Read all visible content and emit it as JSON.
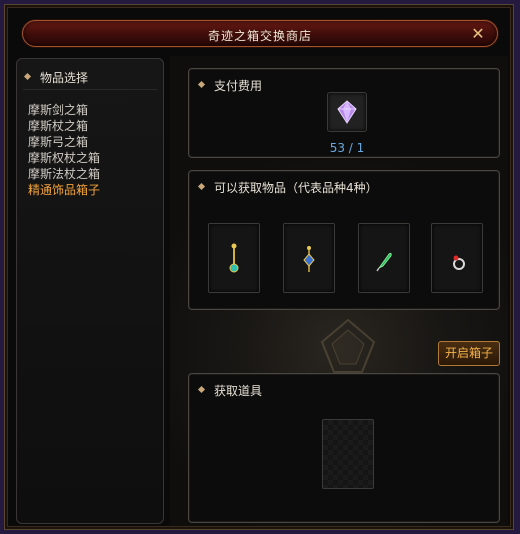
{
  "window": {
    "title": "奇迹之箱交换商店",
    "close_icon": "close-x-icon"
  },
  "sidebar": {
    "header": "物品选择",
    "items": [
      {
        "label": "摩斯剑之箱",
        "selected": false
      },
      {
        "label": "摩斯杖之箱",
        "selected": false
      },
      {
        "label": "摩斯弓之箱",
        "selected": false
      },
      {
        "label": "摩斯权杖之箱",
        "selected": false
      },
      {
        "label": "摩斯法杖之箱",
        "selected": false
      },
      {
        "label": "精通饰品箱子",
        "selected": true
      }
    ]
  },
  "cost": {
    "title": "支付费用",
    "item_icon": "purple-gem-icon",
    "count": "53 / 1"
  },
  "rewards": {
    "title": "可以获取物品（代表品种4种）",
    "items": [
      {
        "icon": "pendant-necklace-icon"
      },
      {
        "icon": "pendant-amulet-icon"
      },
      {
        "icon": "green-feather-icon"
      },
      {
        "icon": "ring-icon"
      }
    ]
  },
  "actions": {
    "open_box_label": "开启箱子"
  },
  "result": {
    "title": "获取道具"
  },
  "colors": {
    "selected_item": "#f2a23a",
    "count_text": "#6aa8e0",
    "title_bar": "#3d0d0a",
    "button_text": "#f4b24a"
  }
}
